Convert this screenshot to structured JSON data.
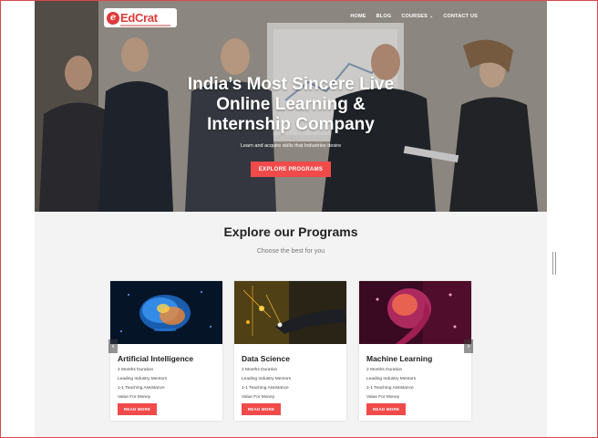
{
  "header": {
    "logo_text": "EdCrat",
    "logo_mark": "e",
    "menu": [
      {
        "label": "HOME"
      },
      {
        "label": "BLOG"
      },
      {
        "label": "COURSES"
      },
      {
        "label": "CONTACT US"
      }
    ]
  },
  "hero": {
    "title_line1": "India’s Most Sincere Live",
    "title_line2": "Online Learning &",
    "title_line3": "Internship Company",
    "subtitle": "Learn and acquire skills that Industries desire",
    "cta_label": "EXPLORE PROGRAMS"
  },
  "programs": {
    "title": "Explore our Programs",
    "subtitle": "Choose the best for you",
    "cards": [
      {
        "title": "Artificial Intelligence",
        "features": [
          "2 Months Duration",
          "Leading Industry Mentors",
          "1-1 Teaching Assistance",
          "Value For Money"
        ],
        "button": "READ MORE"
      },
      {
        "title": "Data Science",
        "features": [
          "2 Months Duration",
          "Leading Industry Mentors",
          "1-1 Teaching Assistance",
          "Value For Money"
        ],
        "button": "READ MORE"
      },
      {
        "title": "Machine Learning",
        "features": [
          "2 Months Duration",
          "Leading Industry Mentors",
          "1-1 Teaching Assistance",
          "Value For Money"
        ],
        "button": "READ MORE"
      }
    ],
    "prev_arrow": "‹",
    "next_arrow": "›"
  },
  "colors": {
    "accent": "#f04a4a",
    "logo_red": "#e03a3a"
  }
}
